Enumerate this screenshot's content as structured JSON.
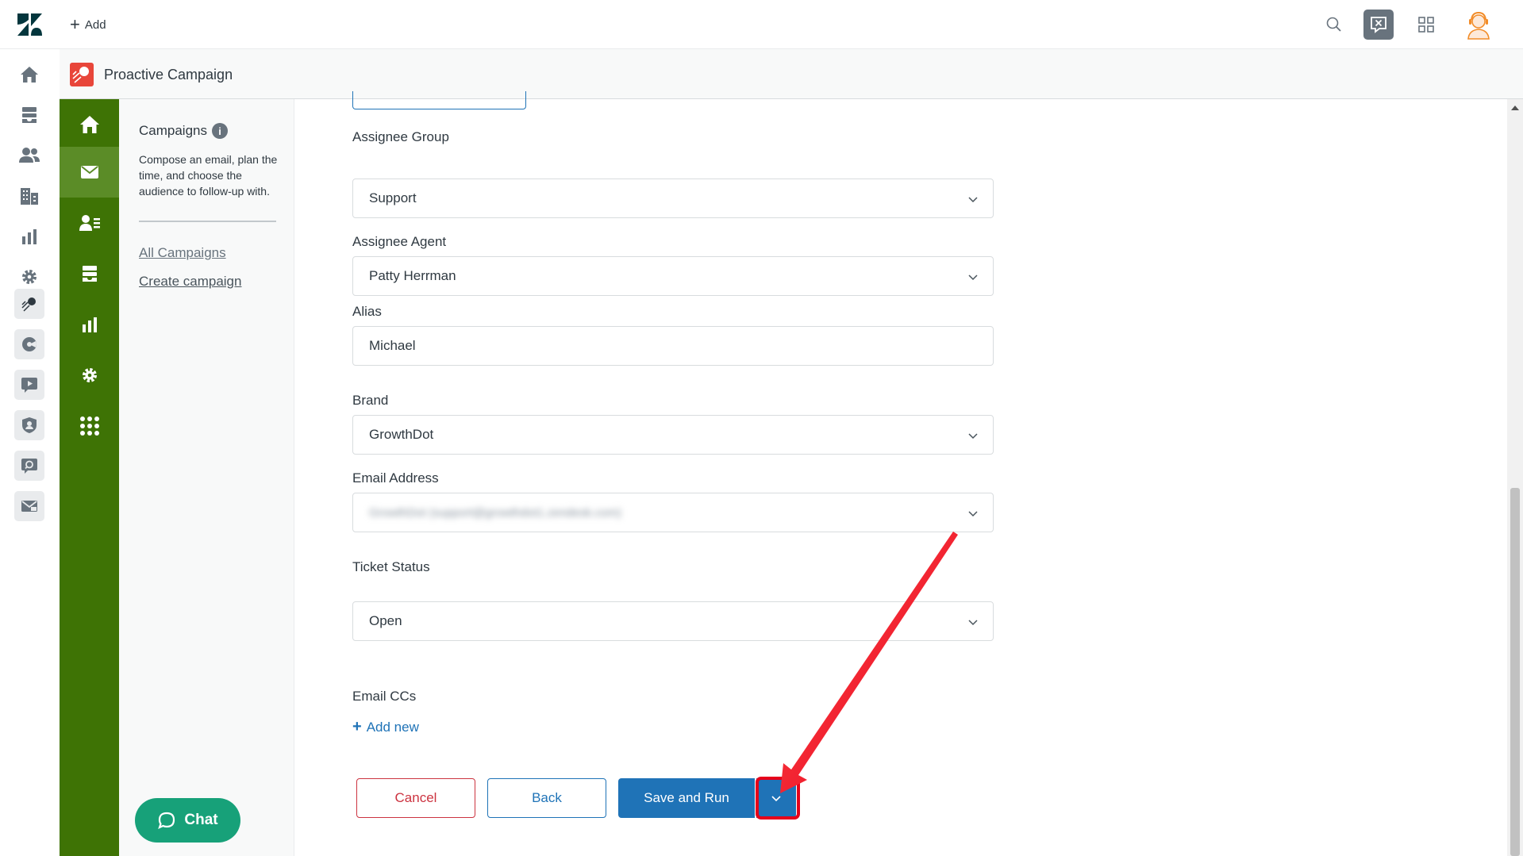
{
  "topbar": {
    "add_label": "Add"
  },
  "app": {
    "title": "Proactive Campaign"
  },
  "side_panel": {
    "title": "Campaigns",
    "info_glyph": "i",
    "description": "Compose an email, plan the time, and choose the audience to follow-up with.",
    "links": {
      "all_campaigns": "All Campaigns",
      "create_campaign": "Create campaign"
    }
  },
  "form": {
    "assignee_group": {
      "label": "Assignee Group",
      "value": "Support"
    },
    "assignee_agent": {
      "label": "Assignee Agent",
      "value": "Patty Herrman"
    },
    "alias": {
      "label": "Alias",
      "value": "Michael"
    },
    "brand": {
      "label": "Brand",
      "value": "GrowthDot"
    },
    "email_address": {
      "label": "Email Address",
      "value": "GrowthDot (support@growthdot1.zendesk.com)"
    },
    "ticket_status": {
      "label": "Ticket Status",
      "value": "Open"
    },
    "email_ccs": {
      "label": "Email CCs",
      "add_new": "Add new"
    }
  },
  "buttons": {
    "cancel": "Cancel",
    "back": "Back",
    "save_and_run": "Save and Run"
  },
  "chat_widget": {
    "label": "Chat"
  },
  "colors": {
    "green_nav": "#3e7305",
    "green_nav_active": "#5b8c27",
    "primary_blue": "#1f73b7",
    "cancel_red": "#cc3340",
    "chat_green": "#17a179",
    "annotation_red": "#e6001a"
  },
  "icons": {
    "global_nav": [
      "home-icon",
      "views-icon",
      "customers-icon",
      "organizations-icon",
      "reporting-icon",
      "admin-gear-icon",
      "proactive-campaign-app-icon",
      "app-icon-2",
      "app-icon-3",
      "app-icon-4",
      "app-icon-5",
      "email-app-icon"
    ],
    "green_nav": [
      "home-icon",
      "email-icon",
      "contacts-icon",
      "list-icon",
      "reports-icon",
      "settings-icon",
      "apps-grid-icon"
    ]
  }
}
